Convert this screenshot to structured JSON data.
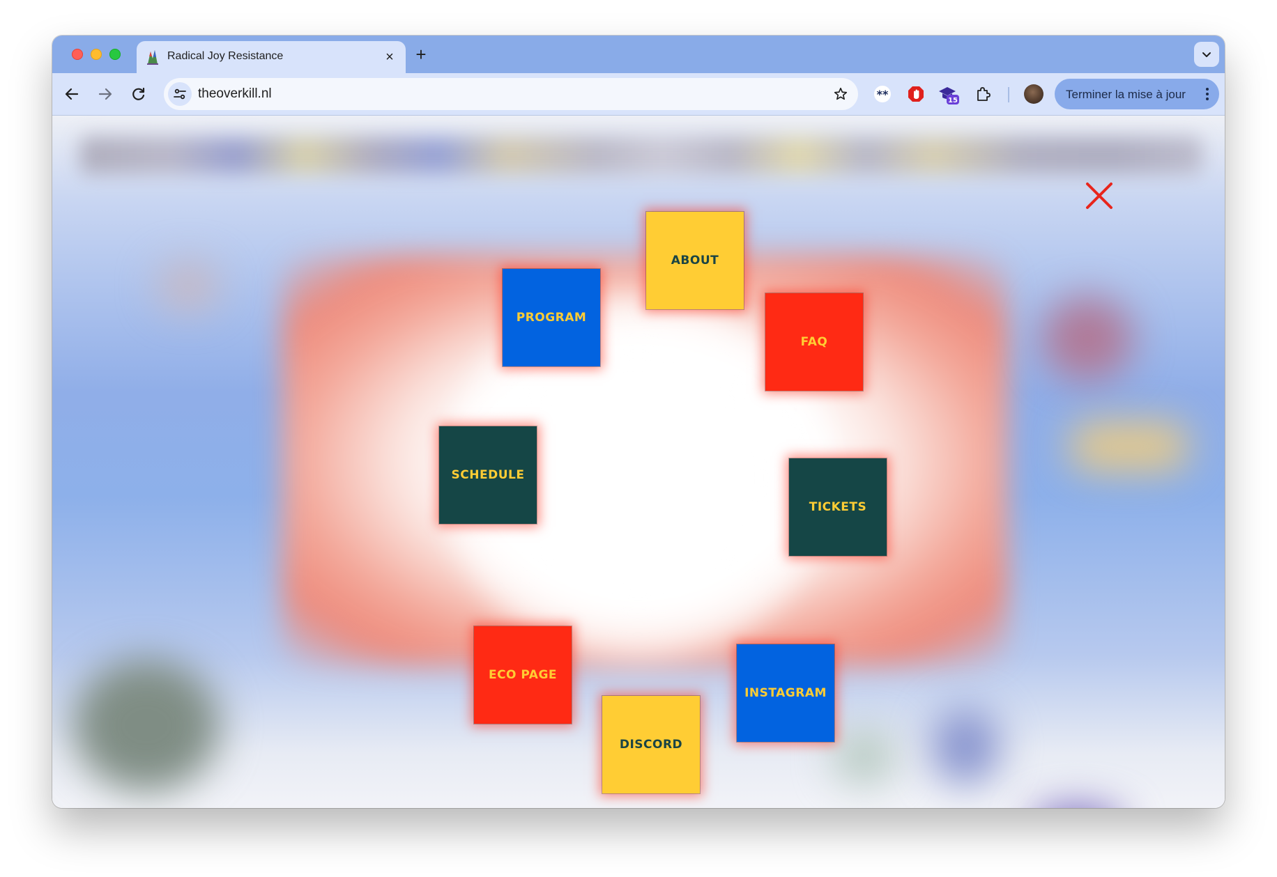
{
  "window": {
    "tab_title": "Radical Joy Resistance",
    "url": "theoverkill.nl",
    "update_button_label": "Terminer la mise à jour",
    "extension_badge": "15"
  },
  "icons": {
    "tab_close": "×",
    "new_tab": "+",
    "back": "back-arrow-icon",
    "forward": "forward-arrow-icon",
    "reload": "reload-icon",
    "site_info": "tune-icon",
    "bookmark": "star-outline-icon",
    "overflow": "three-dots-vertical-icon"
  },
  "menu": {
    "close_color": "#e8251c",
    "tiles": [
      {
        "label": "About",
        "bg": "#ffcd34",
        "fg": "#1a4444"
      },
      {
        "label": "FAQ",
        "bg": "#ff2a14",
        "fg": "#ffcd34"
      },
      {
        "label": "Tickets",
        "bg": "#154646",
        "fg": "#ffcd34"
      },
      {
        "label": "Instagram",
        "bg": "#0263e0",
        "fg": "#ffcd34"
      },
      {
        "label": "Discord",
        "bg": "#ffcd34",
        "fg": "#1a4444"
      },
      {
        "label": "Eco page",
        "bg": "#ff2a14",
        "fg": "#ffcd34"
      },
      {
        "label": "Schedule",
        "bg": "#154646",
        "fg": "#ffcd34"
      },
      {
        "label": "Program",
        "bg": "#0263e0",
        "fg": "#ffcd34"
      }
    ]
  }
}
